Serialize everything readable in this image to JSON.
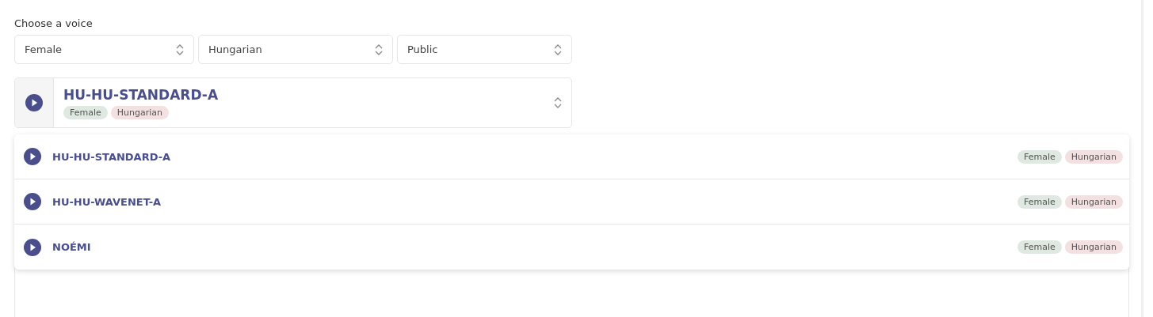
{
  "voice_picker": {
    "label": "Choose a voice",
    "filters": [
      {
        "value": "Female"
      },
      {
        "value": "Hungarian"
      },
      {
        "value": "Public"
      }
    ],
    "selected_voice": {
      "name": "HU-HU-STANDARD-A",
      "tags": [
        {
          "label": "Female",
          "color": "#dfe9e1"
        },
        {
          "label": "Hungarian",
          "color": "#f3e0e1"
        }
      ]
    },
    "options": [
      {
        "name": "HU-HU-STANDARD-A",
        "tags": [
          {
            "label": "Female",
            "color": "#dfe9e1"
          },
          {
            "label": "Hungarian",
            "color": "#f3e0e1"
          }
        ]
      },
      {
        "name": "HU-HU-WAVENET-A",
        "tags": [
          {
            "label": "Female",
            "color": "#dfe9e1"
          },
          {
            "label": "Hungarian",
            "color": "#f3e0e1"
          }
        ]
      },
      {
        "name": "NOÉMI",
        "tags": [
          {
            "label": "Female",
            "color": "#dfe9e1"
          },
          {
            "label": "Hungarian",
            "color": "#f3e0e1"
          }
        ]
      }
    ]
  }
}
